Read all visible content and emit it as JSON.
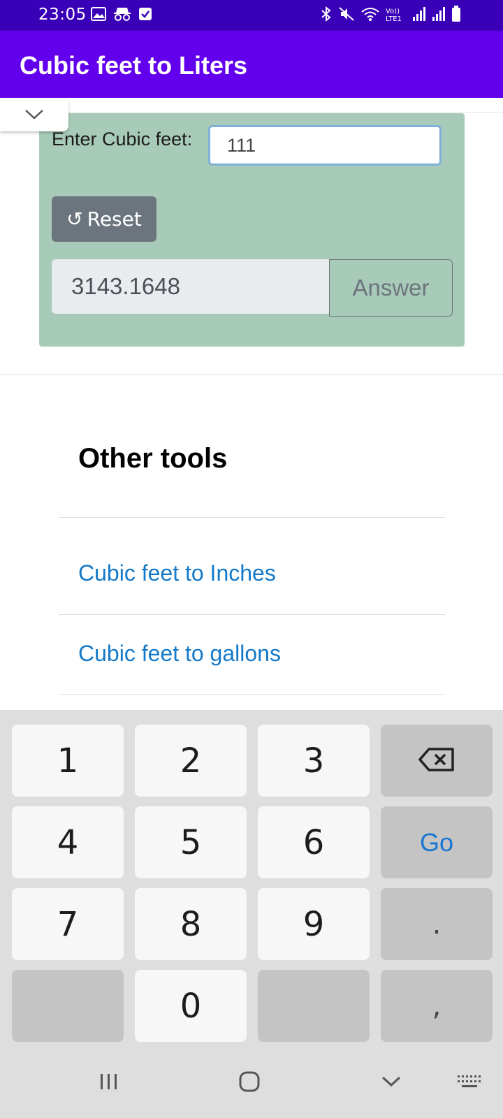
{
  "status_bar": {
    "time": "23:05",
    "network_label": "Vo)) LTE1"
  },
  "app_bar": {
    "title": "Cubic feet to Liters"
  },
  "converter": {
    "input_label": "Enter Cubic feet:",
    "input_value": "111",
    "reset_icon": "↺",
    "reset_label": "Reset",
    "result_value": "3143.1648",
    "answer_label": "Answer"
  },
  "other_tools": {
    "heading": "Other tools",
    "links": [
      {
        "label": "Cubic feet to Inches"
      },
      {
        "label": "Cubic feet to gallons"
      }
    ]
  },
  "keyboard": {
    "keys": {
      "k1": "1",
      "k2": "2",
      "k3": "3",
      "k4": "4",
      "k5": "5",
      "k6": "6",
      "k7": "7",
      "k8": "8",
      "k9": "9",
      "k0": "0",
      "go": "Go",
      "dot": ".",
      "comma": ","
    }
  },
  "colors": {
    "status_bar": "#3a00b8",
    "app_bar": "#6200ee",
    "card": "#a8cbb9",
    "link": "#1479c8",
    "go_key": "#1976d2"
  },
  "icons": {
    "status_left": [
      "gallery-icon",
      "incognito-icon",
      "checkbox-icon"
    ],
    "status_right": [
      "bluetooth-icon",
      "mute-icon",
      "wifi-icon",
      "signal-icon",
      "signal-icon",
      "battery-icon"
    ],
    "nav": [
      "recents-icon",
      "home-icon",
      "back-icon",
      "keyboard-icon"
    ]
  }
}
